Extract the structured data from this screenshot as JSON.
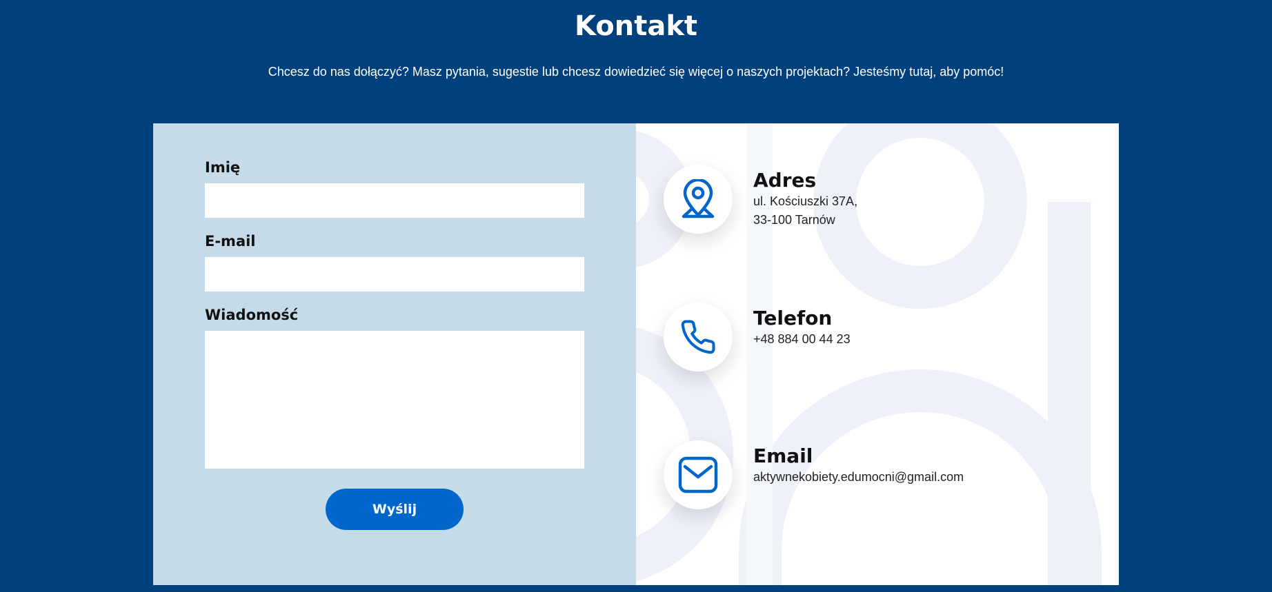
{
  "header": {
    "title": "Kontakt",
    "intro": "Chcesz do nas dołączyć? Masz pytania, sugestie lub chcesz dowiedzieć się więcej o naszych projektach? Jesteśmy tutaj, aby pomóc!"
  },
  "form": {
    "name_label": "Imię",
    "name_value": "",
    "email_label": "E-mail",
    "email_value": "",
    "message_label": "Wiadomość",
    "message_value": "",
    "submit_label": "Wyślij"
  },
  "contact_info": {
    "address": {
      "icon": "map-pin-icon",
      "title": "Adres",
      "line1": "ul. Kościuszki 37A,",
      "line2": "33-100 Tarnów"
    },
    "phone": {
      "icon": "phone-icon",
      "title": "Telefon",
      "value": "+48 884 00 44 23"
    },
    "email": {
      "icon": "envelope-icon",
      "title": "Email",
      "value": "aktywnekobiety.edumocni@gmail.com"
    }
  },
  "colors": {
    "page_background": "#00417d",
    "form_panel_background": "#c5dbea",
    "accent": "#0066cc",
    "info_panel_background": "#ffffff",
    "decorative_shapes": "#eef2f8"
  }
}
